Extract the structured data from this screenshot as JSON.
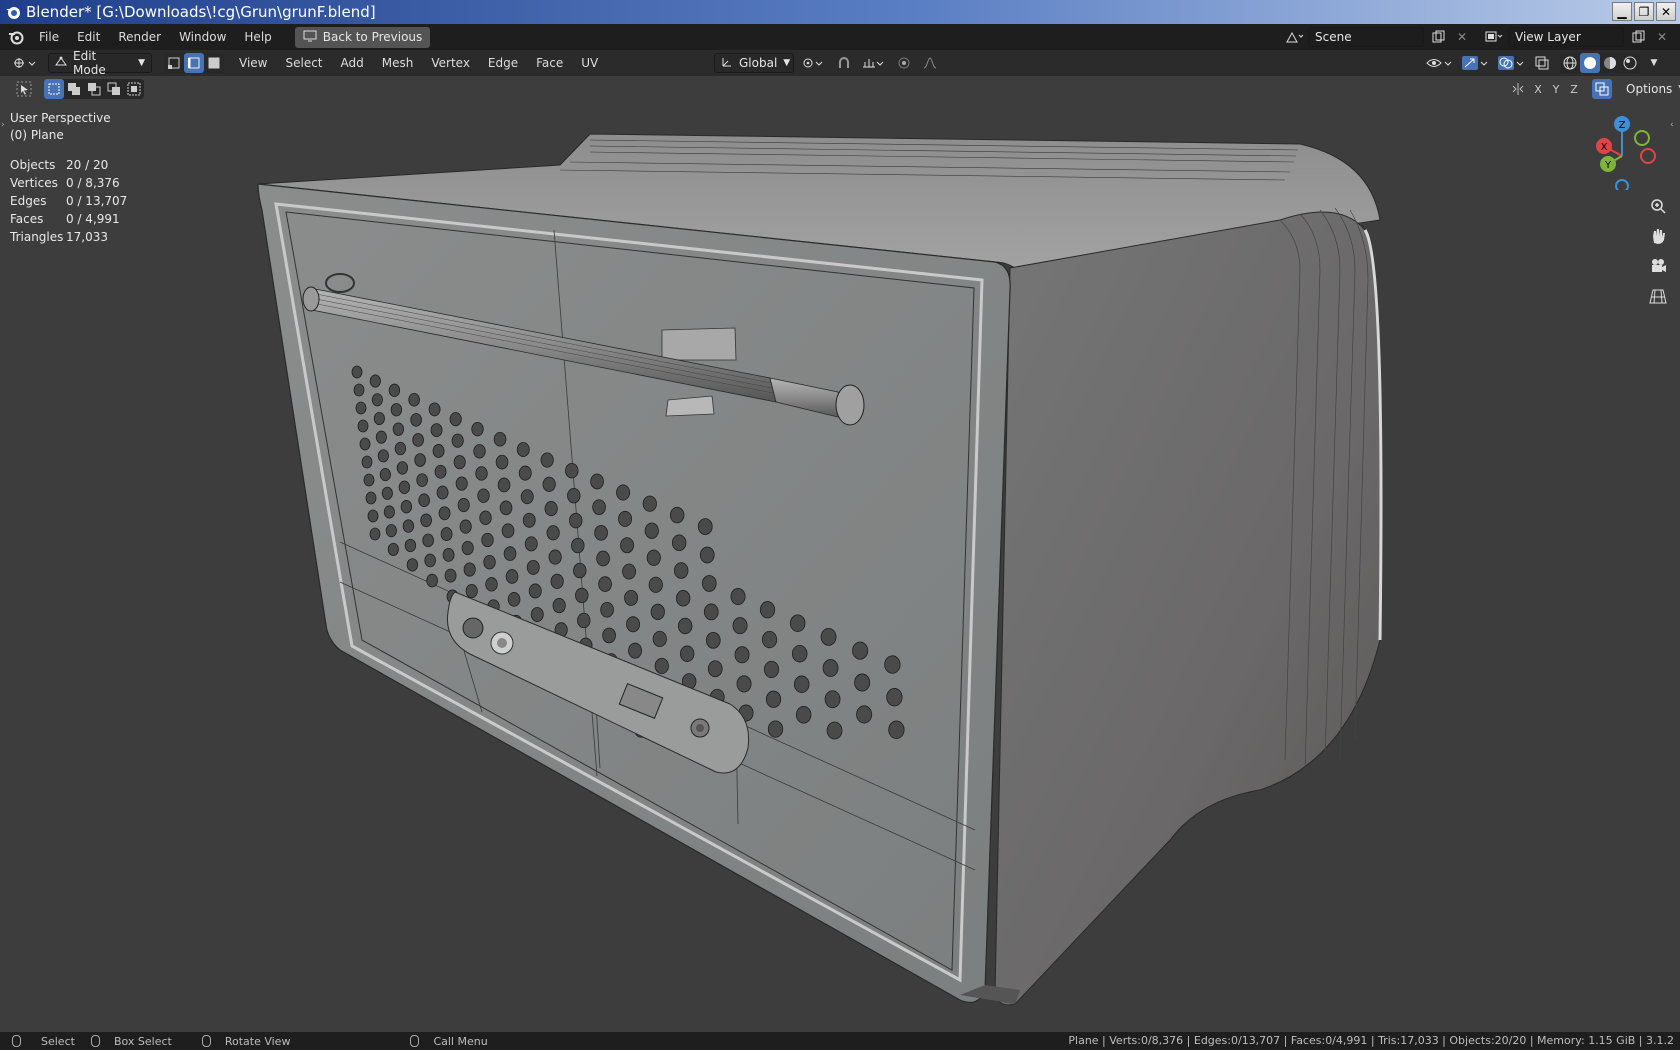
{
  "window": {
    "title": "Blender* [G:\\Downloads\\!cg\\Grun\\grunF.blend]",
    "buttons": {
      "minimize": "▁",
      "restore": "❐",
      "close": "✕"
    }
  },
  "menubar": {
    "items": [
      "File",
      "Edit",
      "Render",
      "Window",
      "Help"
    ],
    "back_button": "Back to Previous",
    "scene_label": "Scene",
    "view_layer_label": "View Layer"
  },
  "header": {
    "mode": "Edit Mode",
    "menus": [
      "View",
      "Select",
      "Add",
      "Mesh",
      "Vertex",
      "Edge",
      "Face",
      "UV"
    ],
    "transform_orientation": "Global"
  },
  "toolrow": {
    "axes": [
      "X",
      "Y",
      "Z"
    ],
    "options_label": "Options"
  },
  "viewport": {
    "perspective": "User Perspective",
    "object": "(0) Plane",
    "stats": [
      {
        "label": "Objects",
        "value": "20 / 20"
      },
      {
        "label": "Vertices",
        "value": "0 / 8,376"
      },
      {
        "label": "Edges",
        "value": "0 / 13,707"
      },
      {
        "label": "Faces",
        "value": "0 / 4,991"
      },
      {
        "label": "Triangles",
        "value": "17,033"
      }
    ],
    "gizmo_axes": {
      "x": "X",
      "y": "Y",
      "z": "Z"
    }
  },
  "statusbar": {
    "select": "Select",
    "box_select": "Box Select",
    "rotate_view": "Rotate View",
    "call_menu": "Call Menu",
    "info": "Plane | Verts:0/8,376 | Edges:0/13,707 | Faces:0/4,991 | Tris:17,033 | Objects:20/20 | Memory: 1.15 GiB | 3.1.2"
  },
  "colors": {
    "accent": "#4772b3",
    "axis_x": "#e04545",
    "axis_y": "#7db53a",
    "axis_z": "#3d8fd6"
  }
}
